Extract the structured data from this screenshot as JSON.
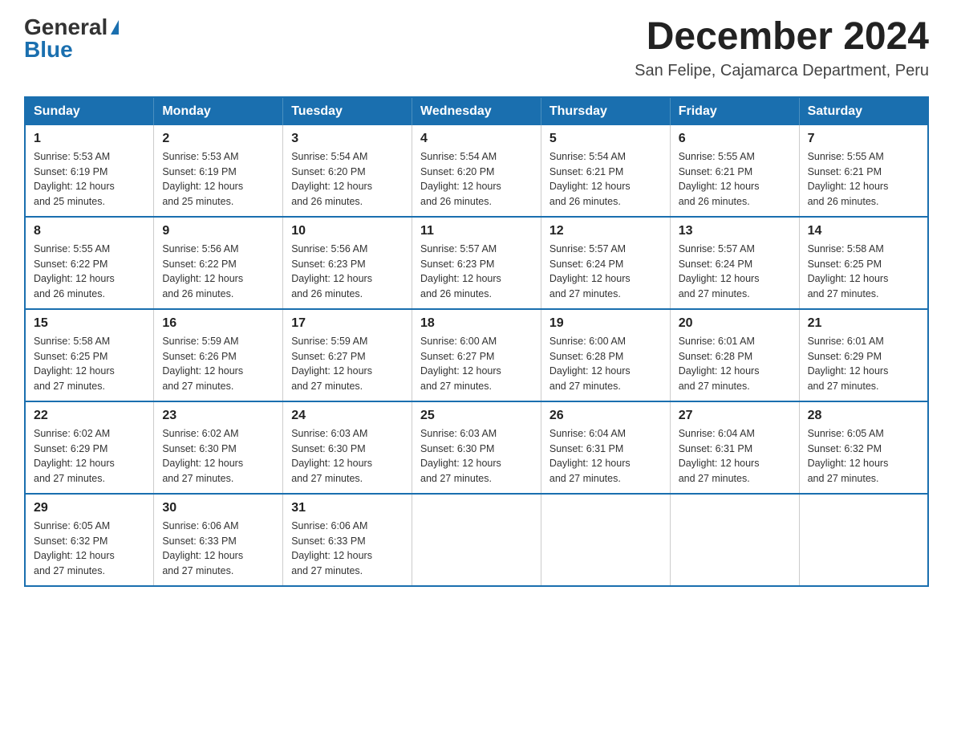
{
  "logo": {
    "general": "General",
    "blue": "Blue",
    "triangle": "▶"
  },
  "title": "December 2024",
  "subtitle": "San Felipe, Cajamarca Department, Peru",
  "days_of_week": [
    "Sunday",
    "Monday",
    "Tuesday",
    "Wednesday",
    "Thursday",
    "Friday",
    "Saturday"
  ],
  "weeks": [
    [
      {
        "day": "1",
        "sunrise": "5:53 AM",
        "sunset": "6:19 PM",
        "daylight": "12 hours and 25 minutes."
      },
      {
        "day": "2",
        "sunrise": "5:53 AM",
        "sunset": "6:19 PM",
        "daylight": "12 hours and 25 minutes."
      },
      {
        "day": "3",
        "sunrise": "5:54 AM",
        "sunset": "6:20 PM",
        "daylight": "12 hours and 26 minutes."
      },
      {
        "day": "4",
        "sunrise": "5:54 AM",
        "sunset": "6:20 PM",
        "daylight": "12 hours and 26 minutes."
      },
      {
        "day": "5",
        "sunrise": "5:54 AM",
        "sunset": "6:21 PM",
        "daylight": "12 hours and 26 minutes."
      },
      {
        "day": "6",
        "sunrise": "5:55 AM",
        "sunset": "6:21 PM",
        "daylight": "12 hours and 26 minutes."
      },
      {
        "day": "7",
        "sunrise": "5:55 AM",
        "sunset": "6:21 PM",
        "daylight": "12 hours and 26 minutes."
      }
    ],
    [
      {
        "day": "8",
        "sunrise": "5:55 AM",
        "sunset": "6:22 PM",
        "daylight": "12 hours and 26 minutes."
      },
      {
        "day": "9",
        "sunrise": "5:56 AM",
        "sunset": "6:22 PM",
        "daylight": "12 hours and 26 minutes."
      },
      {
        "day": "10",
        "sunrise": "5:56 AM",
        "sunset": "6:23 PM",
        "daylight": "12 hours and 26 minutes."
      },
      {
        "day": "11",
        "sunrise": "5:57 AM",
        "sunset": "6:23 PM",
        "daylight": "12 hours and 26 minutes."
      },
      {
        "day": "12",
        "sunrise": "5:57 AM",
        "sunset": "6:24 PM",
        "daylight": "12 hours and 27 minutes."
      },
      {
        "day": "13",
        "sunrise": "5:57 AM",
        "sunset": "6:24 PM",
        "daylight": "12 hours and 27 minutes."
      },
      {
        "day": "14",
        "sunrise": "5:58 AM",
        "sunset": "6:25 PM",
        "daylight": "12 hours and 27 minutes."
      }
    ],
    [
      {
        "day": "15",
        "sunrise": "5:58 AM",
        "sunset": "6:25 PM",
        "daylight": "12 hours and 27 minutes."
      },
      {
        "day": "16",
        "sunrise": "5:59 AM",
        "sunset": "6:26 PM",
        "daylight": "12 hours and 27 minutes."
      },
      {
        "day": "17",
        "sunrise": "5:59 AM",
        "sunset": "6:27 PM",
        "daylight": "12 hours and 27 minutes."
      },
      {
        "day": "18",
        "sunrise": "6:00 AM",
        "sunset": "6:27 PM",
        "daylight": "12 hours and 27 minutes."
      },
      {
        "day": "19",
        "sunrise": "6:00 AM",
        "sunset": "6:28 PM",
        "daylight": "12 hours and 27 minutes."
      },
      {
        "day": "20",
        "sunrise": "6:01 AM",
        "sunset": "6:28 PM",
        "daylight": "12 hours and 27 minutes."
      },
      {
        "day": "21",
        "sunrise": "6:01 AM",
        "sunset": "6:29 PM",
        "daylight": "12 hours and 27 minutes."
      }
    ],
    [
      {
        "day": "22",
        "sunrise": "6:02 AM",
        "sunset": "6:29 PM",
        "daylight": "12 hours and 27 minutes."
      },
      {
        "day": "23",
        "sunrise": "6:02 AM",
        "sunset": "6:30 PM",
        "daylight": "12 hours and 27 minutes."
      },
      {
        "day": "24",
        "sunrise": "6:03 AM",
        "sunset": "6:30 PM",
        "daylight": "12 hours and 27 minutes."
      },
      {
        "day": "25",
        "sunrise": "6:03 AM",
        "sunset": "6:30 PM",
        "daylight": "12 hours and 27 minutes."
      },
      {
        "day": "26",
        "sunrise": "6:04 AM",
        "sunset": "6:31 PM",
        "daylight": "12 hours and 27 minutes."
      },
      {
        "day": "27",
        "sunrise": "6:04 AM",
        "sunset": "6:31 PM",
        "daylight": "12 hours and 27 minutes."
      },
      {
        "day": "28",
        "sunrise": "6:05 AM",
        "sunset": "6:32 PM",
        "daylight": "12 hours and 27 minutes."
      }
    ],
    [
      {
        "day": "29",
        "sunrise": "6:05 AM",
        "sunset": "6:32 PM",
        "daylight": "12 hours and 27 minutes."
      },
      {
        "day": "30",
        "sunrise": "6:06 AM",
        "sunset": "6:33 PM",
        "daylight": "12 hours and 27 minutes."
      },
      {
        "day": "31",
        "sunrise": "6:06 AM",
        "sunset": "6:33 PM",
        "daylight": "12 hours and 27 minutes."
      },
      null,
      null,
      null,
      null
    ]
  ],
  "labels": {
    "sunrise": "Sunrise:",
    "sunset": "Sunset:",
    "daylight": "Daylight:"
  }
}
